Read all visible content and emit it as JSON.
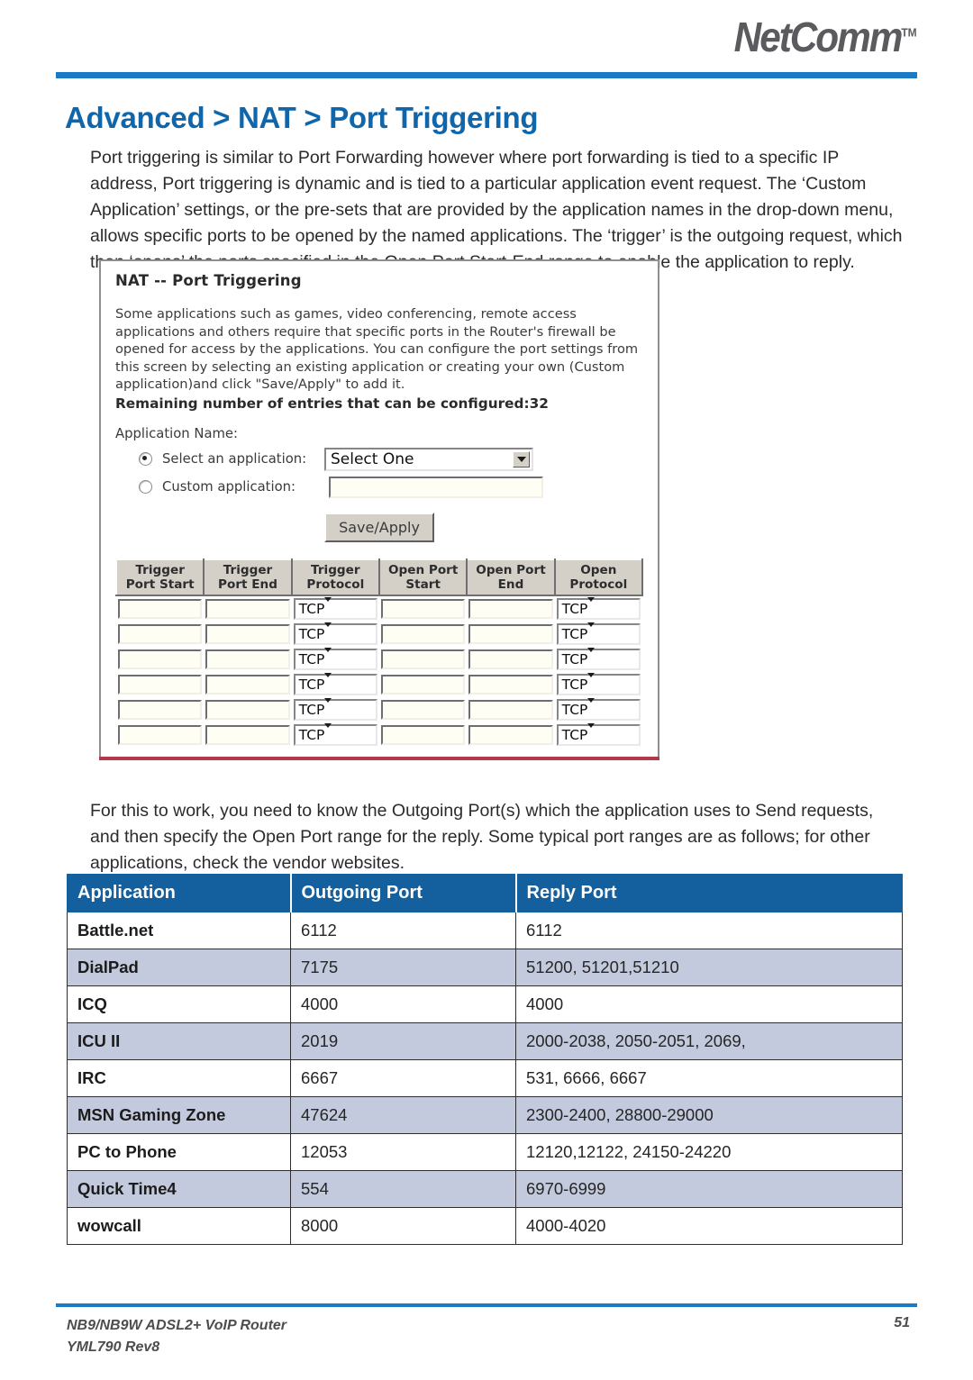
{
  "brand": {
    "logo_text": "NetComm",
    "logo_tm": "TM"
  },
  "page_title": "Advanced > NAT > Port Triggering",
  "intro_paragraph": "Port triggering is similar to Port Forwarding however where port forwarding is tied to a specific IP address, Port triggering is dynamic and is tied to a particular application event request.  The ‘Custom Application’ settings, or the pre-sets that are provided by the application names in the drop-down menu, allows specific ports to be opened by the named applications. The ‘trigger’ is the outgoing request, which then ‘opens’ the ports specified in the Open Port Start-End range to enable the application to reply.",
  "router_screenshot": {
    "heading": "NAT -- Port Triggering",
    "description": "Some applications such as games, video conferencing, remote access applications and others require that specific ports in the Router's firewall be opened for access by the applications. You can configure the port settings from this screen by selecting an existing application or creating your own (Custom application)and click \"Save/Apply\" to add it.",
    "remaining_entries": "Remaining number of entries that can be configured:32",
    "application_name_label": "Application Name:",
    "select_application_label": "Select an application:",
    "select_application_value": "Select One",
    "custom_application_label": "Custom application:",
    "custom_application_value": "",
    "save_apply_label": "Save/Apply",
    "grid": {
      "headers": [
        "Trigger\nPort Start",
        "Trigger\nPort End",
        "Trigger\nProtocol",
        "Open Port\nStart",
        "Open Port\nEnd",
        "Open\nProtocol"
      ],
      "headers_lines": [
        [
          "Trigger",
          "Port Start"
        ],
        [
          "Trigger",
          "Port End"
        ],
        [
          "Trigger",
          "Protocol"
        ],
        [
          "Open Port",
          "Start"
        ],
        [
          "Open Port",
          "End"
        ],
        [
          "Open",
          "Protocol"
        ]
      ],
      "protocol_value": "TCP",
      "row_count": 6
    }
  },
  "second_paragraph": "For this to work, you need to know the Outgoing Port(s) which the application uses to Send requests, and then specify the Open Port range for the reply. Some typical port ranges are as follows; for other applications, check the vendor websites.",
  "port_table": {
    "headers": [
      "Application",
      "Outgoing Port",
      "Reply Port"
    ],
    "rows": [
      {
        "application": "Battle.net",
        "outgoing": "6112",
        "reply": "6112"
      },
      {
        "application": "DialPad",
        "outgoing": "7175",
        "reply": "51200, 51201,51210"
      },
      {
        "application": "ICQ",
        "outgoing": "4000",
        "reply": "4000"
      },
      {
        "application": "ICU II",
        "outgoing": "2019",
        "reply": "2000-2038, 2050-2051, 2069,"
      },
      {
        "application": "IRC",
        "outgoing": "6667",
        "reply": "531, 6666, 6667"
      },
      {
        "application": "MSN Gaming Zone",
        "outgoing": "47624",
        "reply": "2300-2400, 28800-29000"
      },
      {
        "application": "PC to Phone",
        "outgoing": "12053",
        "reply": "12120,12122, 24150-24220"
      },
      {
        "application": "Quick Time4",
        "outgoing": "554",
        "reply": "6970-6999"
      },
      {
        "application": "wowcall",
        "outgoing": "8000",
        "reply": "4000-4020"
      }
    ]
  },
  "footer": {
    "line1": "NB9/NB9W ADSL2+ VoIP Router",
    "line2": "YML790 Rev8",
    "page_number": "51"
  },
  "colors": {
    "rule_blue": "#1b7ac4",
    "title_blue": "#0f66ab",
    "table_header_blue": "#14609e",
    "table_alt_row": "#c3cadd",
    "logo_gray": "#5b5b5f",
    "clip_line": "#b03a4a"
  }
}
